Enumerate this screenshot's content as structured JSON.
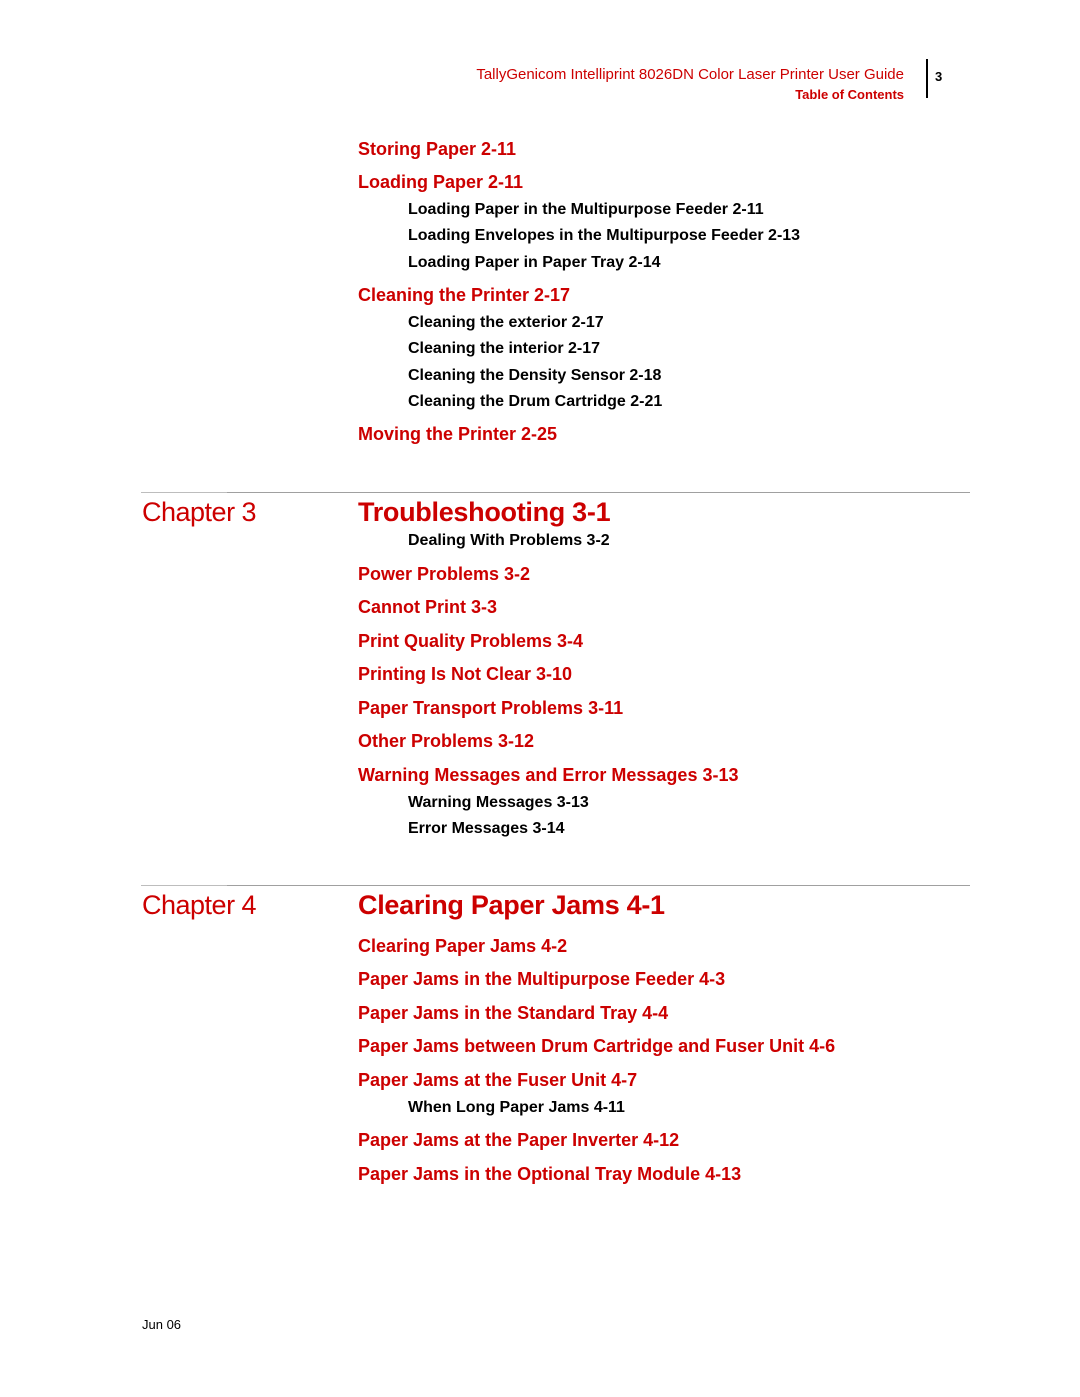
{
  "header": {
    "guide_title": "TallyGenicom Intelliprint 8026DN Color Laser Printer User Guide",
    "section": "Table of Contents",
    "page_number": "3"
  },
  "continued_entries": [
    {
      "level": 1,
      "text": "Storing Paper 2-11"
    },
    {
      "level": 1,
      "text": "Loading Paper 2-11"
    },
    {
      "level": 2,
      "text": "Loading Paper in the Multipurpose Feeder 2-11"
    },
    {
      "level": 2,
      "text": "Loading Envelopes in the Multipurpose Feeder 2-13"
    },
    {
      "level": 2,
      "text": "Loading Paper in Paper Tray 2-14"
    },
    {
      "level": 1,
      "text": "Cleaning the Printer 2-17"
    },
    {
      "level": 2,
      "text": "Cleaning the exterior 2-17"
    },
    {
      "level": 2,
      "text": "Cleaning the interior 2-17"
    },
    {
      "level": 2,
      "text": "Cleaning the Density Sensor 2-18"
    },
    {
      "level": 2,
      "text": "Cleaning the Drum Cartridge 2-21"
    },
    {
      "level": 1,
      "text": "Moving the Printer 2-25"
    }
  ],
  "chapters": [
    {
      "label": "Chapter 3",
      "title": "Troubleshooting 3-1",
      "entries": [
        {
          "level": 2,
          "text": "Dealing With Problems 3-2"
        },
        {
          "level": 1,
          "text": "Power Problems 3-2"
        },
        {
          "level": 1,
          "text": "Cannot Print 3-3"
        },
        {
          "level": 1,
          "text": "Print Quality Problems 3-4"
        },
        {
          "level": 1,
          "text": "Printing Is Not Clear 3-10"
        },
        {
          "level": 1,
          "text": "Paper Transport Problems 3-11"
        },
        {
          "level": 1,
          "text": "Other Problems 3-12"
        },
        {
          "level": 1,
          "text": "Warning Messages and Error Messages 3-13"
        },
        {
          "level": 2,
          "text": "Warning Messages 3-13"
        },
        {
          "level": 2,
          "text": "Error Messages 3-14"
        }
      ]
    },
    {
      "label": "Chapter 4",
      "title": "Clearing Paper Jams 4-1",
      "entries": [
        {
          "level": 1,
          "text": "Clearing Paper Jams 4-2"
        },
        {
          "level": 1,
          "text": "Paper Jams in the Multipurpose Feeder 4-3"
        },
        {
          "level": 1,
          "text": "Paper Jams in the Standard Tray 4-4"
        },
        {
          "level": 1,
          "text": "Paper Jams between Drum Cartridge and Fuser Unit 4-6"
        },
        {
          "level": 1,
          "text": "Paper Jams at the Fuser Unit 4-7"
        },
        {
          "level": 2,
          "text": "When Long Paper Jams 4-11"
        },
        {
          "level": 1,
          "text": "Paper Jams at the Paper Inverter 4-12"
        },
        {
          "level": 1,
          "text": "Paper Jams in the Optional Tray Module 4-13"
        }
      ]
    }
  ],
  "footer": {
    "date": "Jun 06"
  },
  "colors": {
    "accent": "#cc0000",
    "text": "#000000",
    "rule": "#a0a0a0"
  }
}
